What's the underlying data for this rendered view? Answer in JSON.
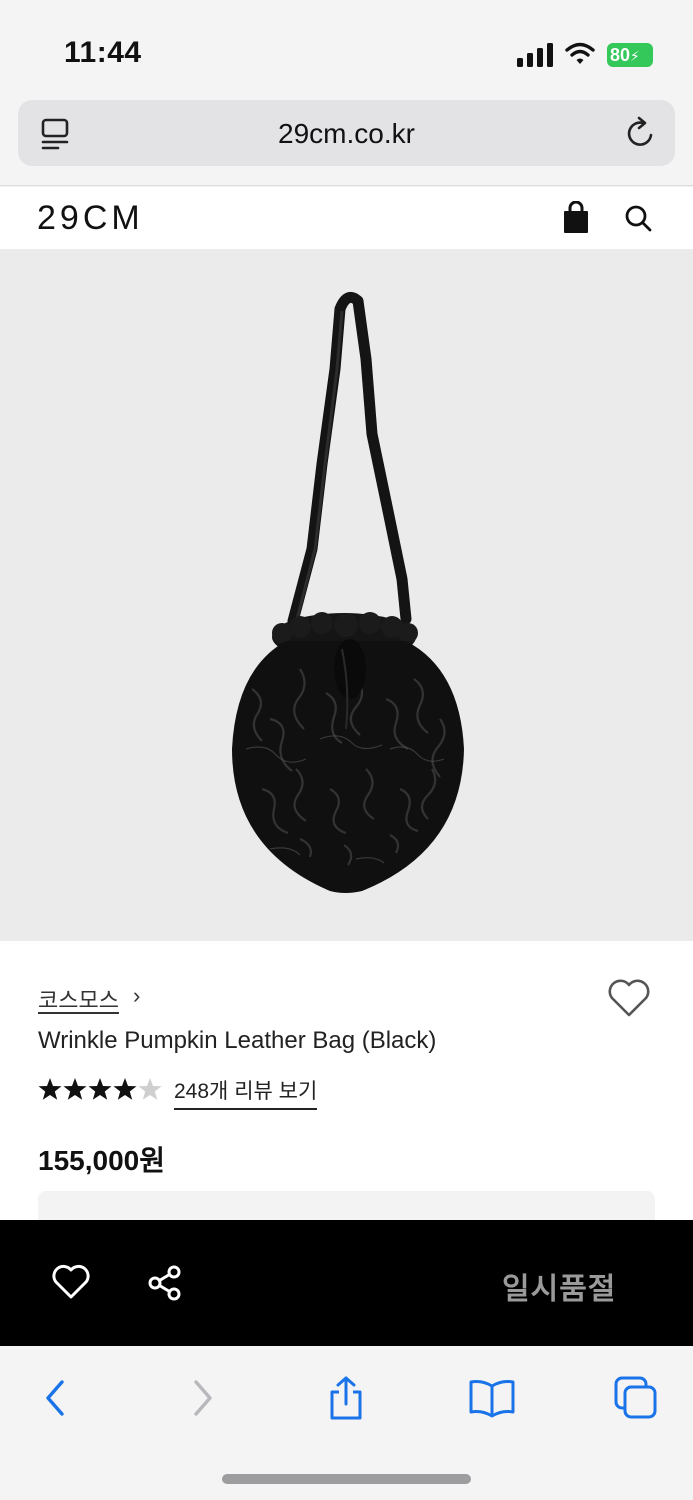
{
  "status_bar": {
    "time": "11:44",
    "battery": "80"
  },
  "browser": {
    "url": "29cm.co.kr"
  },
  "site": {
    "logo": "29CM"
  },
  "product": {
    "brand": "코스모스",
    "brand_chevron": "›",
    "name": "Wrinkle Pumpkin Leather Bag (Black)",
    "rating_stars": 4.5,
    "rating_max": 5,
    "review_link": "248개 리뷰 보기",
    "price": "155,000원"
  },
  "action_bar": {
    "status_label": "일시품절"
  },
  "icons": {
    "reader": "reader-mode-icon",
    "reload": "reload-icon",
    "bag": "shopping-bag-icon",
    "search": "search-icon",
    "heart": "heart-icon",
    "share": "share-icon",
    "back": "back-arrow-icon",
    "forward": "forward-arrow-icon",
    "browser_share": "share-box-icon",
    "bookmarks": "book-icon",
    "tabs": "tabs-icon"
  },
  "colors": {
    "accent": "#1a73e8",
    "battery": "#34c759",
    "action_bar": "#000000",
    "soldout_text": "#9a9a9a"
  }
}
